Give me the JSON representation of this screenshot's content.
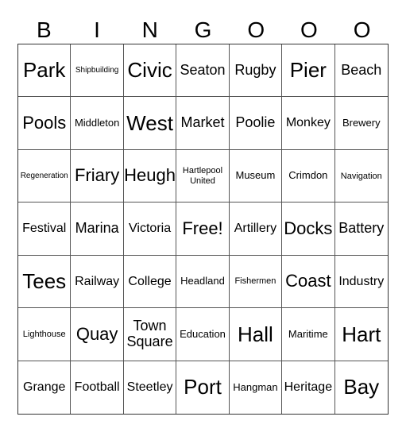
{
  "header": {
    "letters": [
      "B",
      "I",
      "N",
      "G",
      "O",
      "O",
      "O"
    ]
  },
  "board": {
    "rows": [
      [
        "Park",
        "Shipbuilding",
        "Civic",
        "Seaton",
        "Rugby",
        "Pier",
        "Beach"
      ],
      [
        "Pools",
        "Middleton",
        "West",
        "Market",
        "Poolie",
        "Monkey",
        "Brewery"
      ],
      [
        "Regeneration",
        "Friary",
        "Heugh",
        "Hartlepool United",
        "Museum",
        "Crimdon",
        "Navigation"
      ],
      [
        "Festival",
        "Marina",
        "Victoria",
        "Free!",
        "Artillery",
        "Docks",
        "Battery"
      ],
      [
        "Tees",
        "Railway",
        "College",
        "Headland",
        "Fishermen",
        "Coast",
        "Industry"
      ],
      [
        "Lighthouse",
        "Quay",
        "Town Square",
        "Education",
        "Hall",
        "Maritime",
        "Hart"
      ],
      [
        "Grange",
        "Football",
        "Steetley",
        "Port",
        "Hangman",
        "Heritage",
        "Bay"
      ]
    ]
  }
}
